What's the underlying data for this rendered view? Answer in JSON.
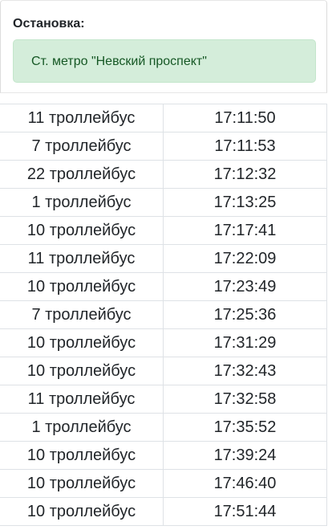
{
  "stop": {
    "label": "Остановка:",
    "name": "Ст. метро \"Невский проспект\""
  },
  "colors": {
    "alert_bg": "#d4edda",
    "alert_text": "#155724",
    "border": "#dee2e6"
  },
  "schedule": [
    {
      "route": "11 троллейбус",
      "time": "17:11:50"
    },
    {
      "route": "7 троллейбус",
      "time": "17:11:53"
    },
    {
      "route": "22 троллейбус",
      "time": "17:12:32"
    },
    {
      "route": "1 троллейбус",
      "time": "17:13:25"
    },
    {
      "route": "10 троллейбус",
      "time": "17:17:41"
    },
    {
      "route": "11 троллейбус",
      "time": "17:22:09"
    },
    {
      "route": "10 троллейбус",
      "time": "17:23:49"
    },
    {
      "route": "7 троллейбус",
      "time": "17:25:36"
    },
    {
      "route": "10 троллейбус",
      "time": "17:31:29"
    },
    {
      "route": "10 троллейбус",
      "time": "17:32:43"
    },
    {
      "route": "11 троллейбус",
      "time": "17:32:58"
    },
    {
      "route": "1 троллейбус",
      "time": "17:35:52"
    },
    {
      "route": "10 троллейбус",
      "time": "17:39:24"
    },
    {
      "route": "10 троллейбус",
      "time": "17:46:40"
    },
    {
      "route": "10 троллейбус",
      "time": "17:51:44"
    }
  ]
}
